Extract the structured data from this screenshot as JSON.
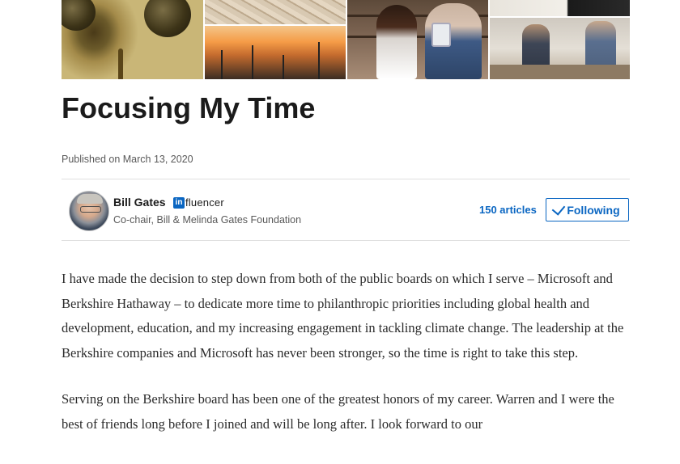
{
  "article": {
    "title": "Focusing My Time",
    "published": "Published on March 13, 2020"
  },
  "author": {
    "name": "Bill Gates",
    "badge_in": "in",
    "badge_text": "fluencer",
    "headline": "Co-chair, Bill & Melinda Gates Foundation",
    "articles_count": "150 articles",
    "follow_label": "Following"
  },
  "body": {
    "p1": "I have made the decision to step down from both of the public boards on which I serve – Microsoft and Berkshire Hathaway – to dedicate more time to philanthropic priorities including global health and development, education, and my increasing engagement in tackling climate change. The leadership at the Berkshire companies and Microsoft has never been stronger, so the time is right to take this step.",
    "p2": "Serving on the Berkshire board has been one of the greatest honors of my career. Warren and I were the best of friends long before I joined and will be long after. I look forward to our"
  },
  "icons": {
    "follow": "check-icon",
    "badge": "linkedin-influencer-icon"
  },
  "colors": {
    "accent": "#0a66c2",
    "title": "#1b1b1b",
    "muted": "#595959"
  }
}
